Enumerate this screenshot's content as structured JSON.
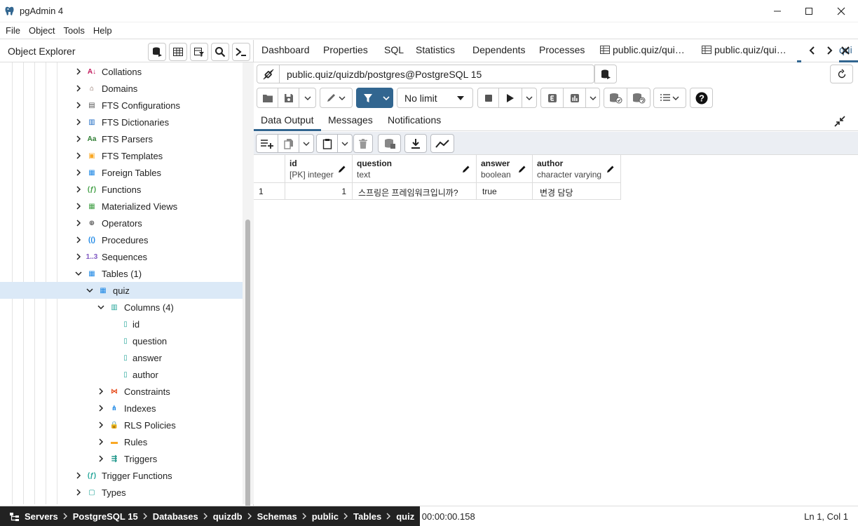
{
  "window": {
    "title": "pgAdmin 4"
  },
  "menu": [
    "File",
    "Object",
    "Tools",
    "Help"
  ],
  "object_explorer": {
    "title": "Object Explorer",
    "tree": [
      {
        "label": "Collations",
        "icon": "collations-icon",
        "level": 0,
        "expanded": false
      },
      {
        "label": "Domains",
        "icon": "domains-icon",
        "level": 0,
        "expanded": false
      },
      {
        "label": "FTS Configurations",
        "icon": "fts-configurations-icon",
        "level": 0,
        "expanded": false
      },
      {
        "label": "FTS Dictionaries",
        "icon": "fts-dictionaries-icon",
        "level": 0,
        "expanded": false
      },
      {
        "label": "FTS Parsers",
        "icon": "fts-parsers-icon",
        "level": 0,
        "expanded": false
      },
      {
        "label": "FTS Templates",
        "icon": "fts-templates-icon",
        "level": 0,
        "expanded": false
      },
      {
        "label": "Foreign Tables",
        "icon": "foreign-tables-icon",
        "level": 0,
        "expanded": false
      },
      {
        "label": "Functions",
        "icon": "functions-icon",
        "level": 0,
        "expanded": false
      },
      {
        "label": "Materialized Views",
        "icon": "materialized-views-icon",
        "level": 0,
        "expanded": false
      },
      {
        "label": "Operators",
        "icon": "operators-icon",
        "level": 0,
        "expanded": false
      },
      {
        "label": "Procedures",
        "icon": "procedures-icon",
        "level": 0,
        "expanded": false
      },
      {
        "label": "Sequences",
        "icon": "sequences-icon",
        "level": 0,
        "expanded": false
      },
      {
        "label": "Tables (1)",
        "icon": "tables-icon",
        "level": 0,
        "expanded": true
      },
      {
        "label": "quiz",
        "icon": "table-icon",
        "level": 1,
        "expanded": true,
        "selected": true
      },
      {
        "label": "Columns (4)",
        "icon": "columns-icon",
        "level": 2,
        "expanded": true
      },
      {
        "label": "id",
        "icon": "column-icon",
        "level": 3,
        "leaf": true
      },
      {
        "label": "question",
        "icon": "column-icon",
        "level": 3,
        "leaf": true
      },
      {
        "label": "answer",
        "icon": "column-icon",
        "level": 3,
        "leaf": true
      },
      {
        "label": "author",
        "icon": "column-icon",
        "level": 3,
        "leaf": true
      },
      {
        "label": "Constraints",
        "icon": "constraints-icon",
        "level": 2,
        "expanded": false
      },
      {
        "label": "Indexes",
        "icon": "indexes-icon",
        "level": 2,
        "expanded": false
      },
      {
        "label": "RLS Policies",
        "icon": "rls-policies-icon",
        "level": 2,
        "expanded": false
      },
      {
        "label": "Rules",
        "icon": "rules-icon",
        "level": 2,
        "expanded": false
      },
      {
        "label": "Triggers",
        "icon": "triggers-icon",
        "level": 2,
        "expanded": false
      },
      {
        "label": "Trigger Functions",
        "icon": "trigger-functions-icon",
        "level": 0,
        "expanded": false
      },
      {
        "label": "Types",
        "icon": "types-icon",
        "level": 0,
        "expanded": false
      }
    ]
  },
  "breadcrumb": [
    "Servers",
    "PostgreSQL 15",
    "Databases",
    "quizdb",
    "Schemas",
    "public",
    "Tables",
    "quiz"
  ],
  "tabs": [
    {
      "label": "Dashboard"
    },
    {
      "label": "Properties"
    },
    {
      "label": "SQL"
    },
    {
      "label": "Statistics"
    },
    {
      "label": "Dependents"
    },
    {
      "label": "Processes"
    },
    {
      "label": "public.quiz/qui…"
    },
    {
      "label": "public.quiz/qui…"
    },
    {
      "label": "qui"
    }
  ],
  "connection": {
    "text": "public.quiz/quizdb/postgres@PostgreSQL 15"
  },
  "query_toolbar": {
    "limit_value": "No limit"
  },
  "result_tabs": [
    "Data Output",
    "Messages",
    "Notifications"
  ],
  "grid": {
    "columns": [
      {
        "name": "id",
        "type": "[PK] integer"
      },
      {
        "name": "question",
        "type": "text"
      },
      {
        "name": "answer",
        "type": "boolean"
      },
      {
        "name": "author",
        "type": "character varying"
      }
    ],
    "rows": [
      {
        "row_number": "1",
        "cells": [
          "1",
          "스프링은 프레임워크입니까?",
          "true",
          "변경 담당"
        ]
      }
    ]
  },
  "status": {
    "message": "plete 00:00:00.158",
    "cursor": "Ln 1, Col 1"
  },
  "colors": {
    "accent": "#326690",
    "selection": "#dbe9f7",
    "breadcrumb_bg": "#222222"
  }
}
